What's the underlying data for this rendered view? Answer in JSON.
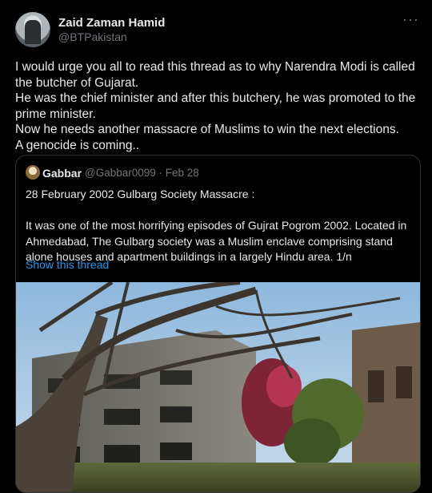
{
  "tweet": {
    "author_name": "Zaid Zaman Hamid",
    "author_handle": "@BTPakistan",
    "more_label": "···",
    "text": "I would urge you all to read this thread as to why Narendra Modi is called the butcher of Gujarat.\nHe was the chief minister and after this butchery, he was promoted to the prime minister.\nNow he needs another massacre of Muslims to win the next elections.\nA genocide is coming.."
  },
  "quote": {
    "author_name": "Gabbar",
    "meta": "@Gabbar0099 · Feb 28",
    "text": "28 February 2002 Gulbarg Society Massacre :\n\nIt was one of the most horrifying episodes of Gujrat Pogrom 2002. Located in Ahmedabad, The Gulbarg society was a Muslim enclave comprising stand alone houses and apartment buildings in a largely Hindu area. 1/n",
    "show_thread_label": "Show this thread"
  },
  "colors": {
    "background": "#000000",
    "text": "#e7e9ea",
    "secondary": "#71767b",
    "link": "#1d9bf0",
    "border": "#2f3336"
  },
  "icons": [
    "avatar",
    "more-icon",
    "quote-avatar"
  ]
}
